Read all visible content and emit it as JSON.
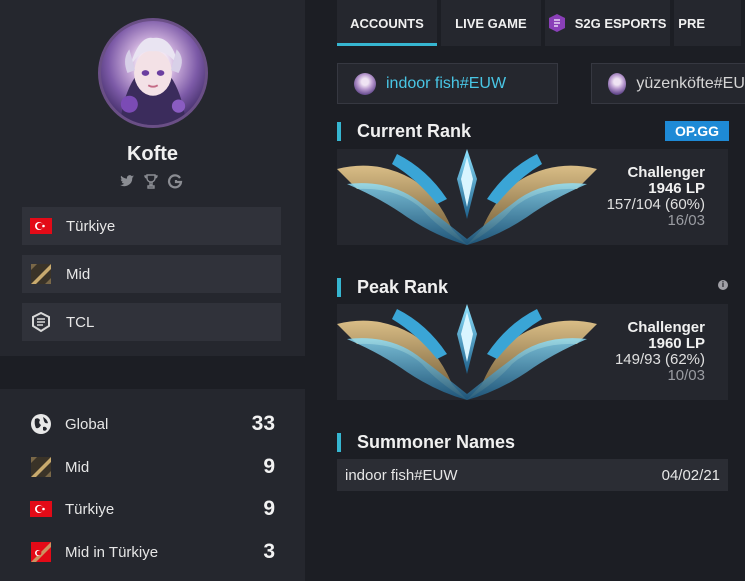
{
  "profile": {
    "name": "Kofte",
    "social_icons": [
      "twitter-icon",
      "trophy-icon",
      "gamepedia-icon"
    ],
    "info": [
      {
        "icon": "flag-turkey-icon",
        "label": "Türkiye"
      },
      {
        "icon": "role-mid-icon",
        "label": "Mid"
      },
      {
        "icon": "team-tcl-icon",
        "label": "TCL"
      }
    ]
  },
  "rankings": [
    {
      "icon": "globe-icon",
      "label": "Global",
      "value": "33"
    },
    {
      "icon": "role-mid-icon",
      "label": "Mid",
      "value": "9"
    },
    {
      "icon": "flag-turkey-icon",
      "label": "Türkiye",
      "value": "9"
    },
    {
      "icon": "mid-turkey-icon",
      "label": "Mid in Türkiye",
      "value": "3"
    }
  ],
  "tabs": [
    {
      "label": "ACCOUNTS",
      "active": true
    },
    {
      "label": "LIVE GAME",
      "active": false
    },
    {
      "label": "S2G ESPORTS",
      "active": false
    },
    {
      "label": "PRE",
      "active": false
    }
  ],
  "accounts": [
    {
      "label": "indoor fish#EUW",
      "selected": true
    },
    {
      "label": "yüzenköfte#EUW",
      "selected": false
    }
  ],
  "current_rank": {
    "title": "Current Rank",
    "badge": "OP.GG",
    "tier": "Challenger",
    "lp": "1946 LP",
    "record": "157/104 (60%)",
    "date": "16/03"
  },
  "peak_rank": {
    "title": "Peak Rank",
    "info_icon": "info-icon",
    "tier": "Challenger",
    "lp": "1960 LP",
    "record": "149/93 (62%)",
    "date": "10/03"
  },
  "summoner_names": {
    "title": "Summoner Names",
    "rows": [
      {
        "name": "indoor fish#EUW",
        "date": "04/02/21"
      }
    ]
  },
  "colors": {
    "accent": "#36b6d1",
    "link": "#49c6e5",
    "opgg": "#1e8ad6",
    "panel": "#25272e",
    "background": "#1c1e24"
  }
}
